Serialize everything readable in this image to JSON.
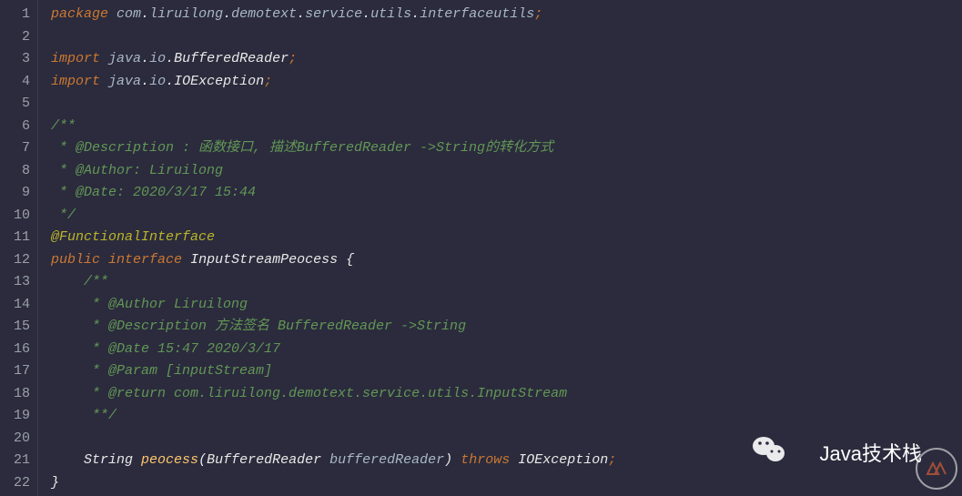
{
  "gutter": [
    "1",
    "2",
    "3",
    "4",
    "5",
    "6",
    "7",
    "8",
    "9",
    "10",
    "11",
    "12",
    "13",
    "14",
    "15",
    "16",
    "17",
    "18",
    "19",
    "20",
    "21",
    "22"
  ],
  "code": {
    "l1": {
      "kw": "package",
      "p1": "com",
      "p2": "liruilong",
      "p3": "demotext",
      "p4": "service",
      "p5": "utils",
      "p6": "interfaceutils",
      "semi": ";"
    },
    "l3": {
      "kw": "import",
      "p1": "java",
      "p2": "io",
      "cls": "BufferedReader",
      "semi": ";"
    },
    "l4": {
      "kw": "import",
      "p1": "java",
      "p2": "io",
      "cls": "IOException",
      "semi": ";"
    },
    "l6": "/**",
    "l7": " * @Description : 函数接口, 描述BufferedReader ->String的转化方式",
    "l8": " * @Author: Liruilong",
    "l9": " * @Date: 2020/3/17 15:44",
    "l10": " */",
    "l11": "@FunctionalInterface",
    "l12": {
      "kw1": "public",
      "kw2": "interface",
      "name": "InputStreamPeocess",
      "brace": "{"
    },
    "l13": "    /**",
    "l14": "     * @Author Liruilong",
    "l15": "     * @Description 方法签名 BufferedReader ->String",
    "l16": "     * @Date 15:47 2020/3/17",
    "l17": "     * @Param [inputStream]",
    "l18": "     * @return com.liruilong.demotext.service.utils.InputStream",
    "l19": "     **/",
    "l21": {
      "indent": "    ",
      "ret": "String",
      "name": "peocess",
      "ptype": "BufferedReader",
      "pname": "bufferedReader",
      "kw": "throws",
      "exc": "IOException",
      "semi": ";"
    },
    "l22": "}"
  },
  "watermark": {
    "text": "Java技术栈"
  }
}
